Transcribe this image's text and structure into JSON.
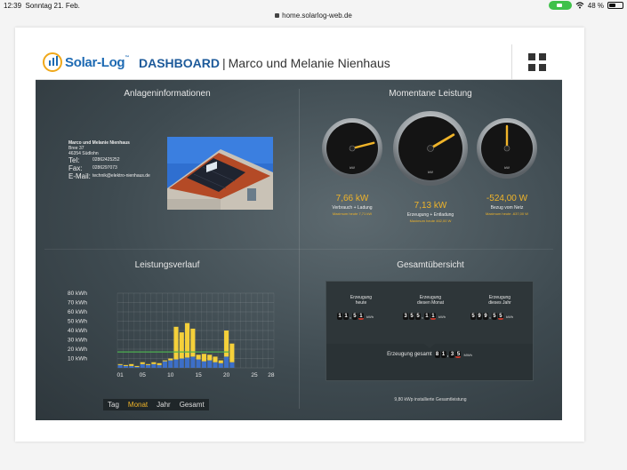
{
  "status_bar": {
    "time": "12:39",
    "date": "Sonntag 21. Feb.",
    "battery": "48 %",
    "battery_level": 0.48,
    "url": "home.solarlog-web.de"
  },
  "header": {
    "logo_text": "Solar-Log",
    "logo_tm": "™",
    "title": "DASHBOARD",
    "separator": "|",
    "owner": "Marco und Melanie Nienhaus",
    "menu_icon": "grid-icon"
  },
  "info": {
    "title": "Anlageninformationen",
    "name": "Marco und Melanie Nienhaus",
    "street": "Bree 37",
    "city": "46354 Südlohn",
    "tel_label": "Tel:",
    "tel": "02862425252",
    "fax_label": "Fax:",
    "fax": "0286297073",
    "email_label": "E-Mail:",
    "email": "technik@elektro-nienhaus.de"
  },
  "current": {
    "title": "Momentane Leistung",
    "gauges": [
      {
        "value": "7,66 kW",
        "label": "Verbrauch + Ladung",
        "max": "Maximum heute 7,71 kW",
        "unit": "kW",
        "level": 0.78
      },
      {
        "value": "7,13 kW",
        "label": "Erzeugung + Entladung",
        "max": "Maximum heute 462,00 W",
        "unit": "kW",
        "level": 0.72
      },
      {
        "value": "-524,00 W",
        "label": "Bezug vom Netz",
        "max": "Maximum heute -637,00 W",
        "unit": "kW",
        "level": 0.5
      }
    ]
  },
  "history": {
    "title": "Leistungsverlauf",
    "tabs": [
      "Tag",
      "Monat",
      "Jahr",
      "Gesamt"
    ],
    "active_tab": "Monat"
  },
  "chart_data": {
    "type": "bar",
    "xlabel": "",
    "ylabel": "",
    "ylim": [
      0,
      80
    ],
    "y_ticks": [
      "10 kWh",
      "20 kWh",
      "30 kWh",
      "40 kWh",
      "50 kWh",
      "60 kWh",
      "70 kWh",
      "80 kWh"
    ],
    "x_ticks": [
      "01",
      "05",
      "10",
      "15",
      "20",
      "25",
      "28"
    ],
    "categories": [
      "1",
      "2",
      "3",
      "4",
      "5",
      "6",
      "7",
      "8",
      "9",
      "10",
      "11",
      "12",
      "13",
      "14",
      "15",
      "16",
      "17",
      "18",
      "19",
      "20",
      "21"
    ],
    "series": [
      {
        "values": [
          3,
          2,
          2,
          1,
          4,
          3,
          4,
          3,
          7,
          8,
          9,
          10,
          11,
          12,
          9,
          7,
          8,
          6,
          5,
          12,
          6
        ],
        "color": "#3d6fc7"
      },
      {
        "values": [
          1,
          1,
          2,
          1,
          2,
          1,
          2,
          2,
          1,
          2,
          35,
          28,
          37,
          30,
          5,
          8,
          6,
          6,
          3,
          28,
          20
        ],
        "color": "#f5d03a"
      }
    ],
    "reference_line": {
      "value": 17,
      "color": "#4caf50"
    },
    "grid": true
  },
  "totals": {
    "title": "Gesamtübersicht",
    "cols": [
      {
        "label1": "Erzeugung",
        "label2": "heute",
        "digits": [
          "1",
          "1",
          "5",
          "1"
        ],
        "unit": "kWh"
      },
      {
        "label1": "Erzeugung",
        "label2": "diesen Monat",
        "digits": [
          "3",
          "5",
          "5",
          "1",
          "1"
        ],
        "unit": "kWh"
      },
      {
        "label1": "Erzeugung",
        "label2": "dieses Jahr",
        "digits": [
          "5",
          "9",
          "9",
          "5",
          "5"
        ],
        "unit": "kWh"
      }
    ],
    "gesamt_label": "Erzeugung gesamt",
    "gesamt_digits": [
      "8",
      "1",
      "3",
      "5"
    ],
    "gesamt_unit": "MWh",
    "installed": "9,80 kWp installierte Gesamtleistung"
  }
}
